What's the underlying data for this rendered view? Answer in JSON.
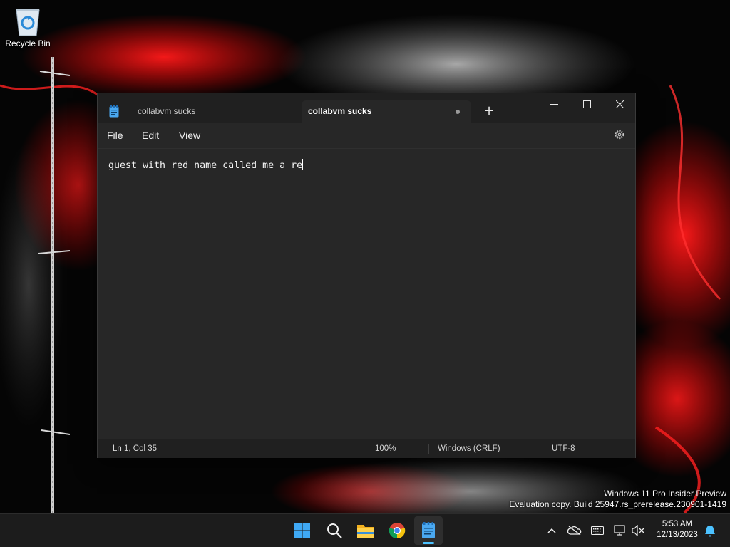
{
  "desktop": {
    "icons": [
      {
        "label": "Recycle Bin",
        "icon": "recycle-bin-icon"
      }
    ]
  },
  "notepad": {
    "tabs": [
      {
        "label": "collabvm sucks",
        "active": false
      },
      {
        "label": "collabvm sucks",
        "active": true,
        "unsaved": true
      }
    ],
    "new_tab_label": "+",
    "menu": [
      "File",
      "Edit",
      "View"
    ],
    "content": "guest with red name called me a re",
    "status": {
      "position": "Ln 1, Col 35",
      "zoom": "100%",
      "line_ending": "Windows (CRLF)",
      "encoding": "UTF-8"
    }
  },
  "watermark": {
    "line1": "Windows 11 Pro Insider Preview",
    "line2": "Evaluation copy. Build 25947.rs_prerelease.230901-1419"
  },
  "taskbar": {
    "apps": [
      "start-icon",
      "search-icon",
      "file-explorer-icon",
      "chrome-icon",
      "notepad-icon"
    ],
    "tray": [
      "chevron-up-icon",
      "onedrive-offline-icon",
      "keyboard-icon",
      "network-icon",
      "volume-muted-icon",
      "notification-bell-icon"
    ],
    "time": "5:53 AM",
    "date": "12/13/2023"
  },
  "colors": {
    "accent": "#4cc2ff",
    "wallpaper_red": "#e00000",
    "window_bg": "#272727",
    "titlebar_bg": "#202020"
  }
}
